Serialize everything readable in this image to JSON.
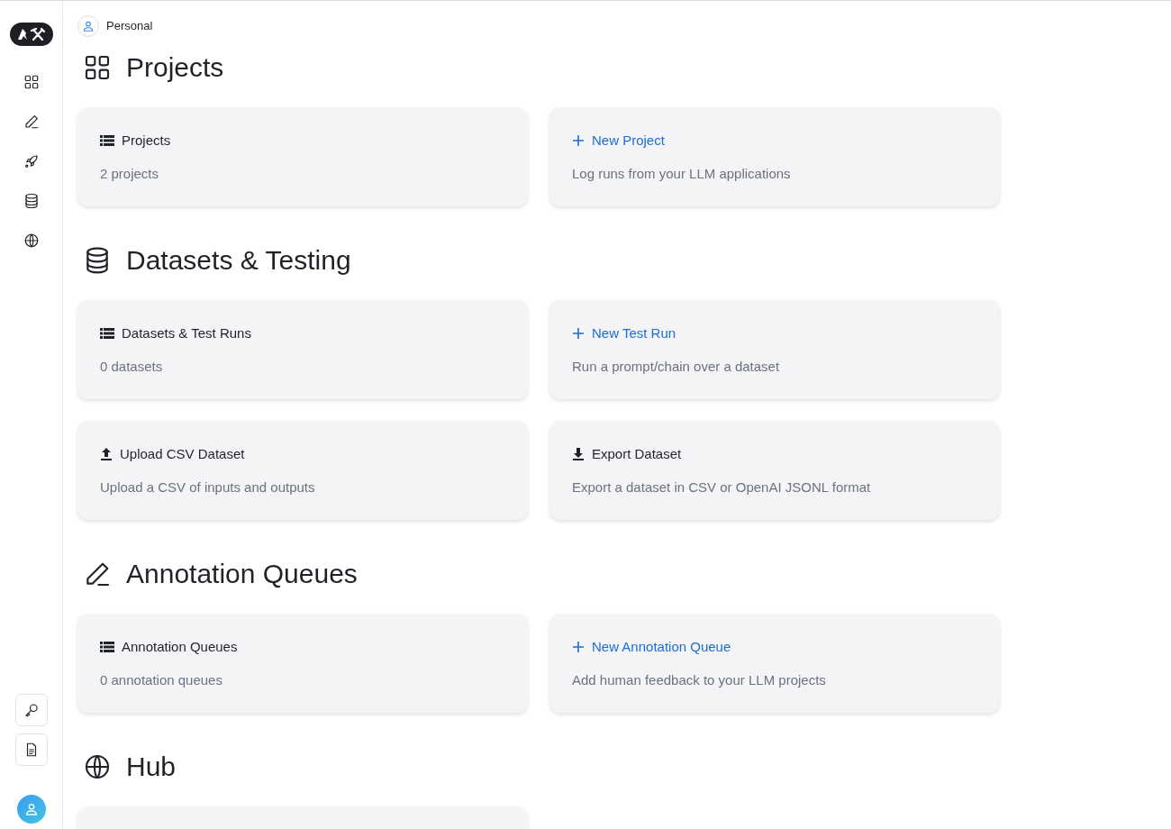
{
  "workspace": {
    "label": "Personal"
  },
  "sections": [
    {
      "title": "Projects",
      "kind": "grid",
      "cards": [
        {
          "kind": "list",
          "title": "Projects",
          "subtitle": "2 projects"
        },
        {
          "kind": "plus",
          "title": "New Project",
          "subtitle": "Log runs from your LLM applications"
        }
      ]
    },
    {
      "title": "Datasets & Testing",
      "kind": "database",
      "cards": [
        {
          "kind": "list",
          "title": "Datasets & Test Runs",
          "subtitle": "0 datasets"
        },
        {
          "kind": "plus",
          "title": "New Test Run",
          "subtitle": "Run a prompt/chain over a dataset"
        },
        {
          "kind": "upload",
          "title": "Upload CSV Dataset",
          "subtitle": "Upload a CSV of inputs and outputs"
        },
        {
          "kind": "download",
          "title": "Export Dataset",
          "subtitle": "Export a dataset in CSV or OpenAI JSONL format"
        }
      ]
    },
    {
      "title": "Annotation Queues",
      "kind": "pencil",
      "cards": [
        {
          "kind": "list",
          "title": "Annotation Queues",
          "subtitle": "0 annotation queues"
        },
        {
          "kind": "plus",
          "title": "New Annotation Queue",
          "subtitle": "Add human feedback to your LLM projects"
        }
      ]
    },
    {
      "title": "Hub",
      "kind": "globe",
      "cards": [
        {
          "kind": "blank"
        }
      ]
    }
  ]
}
